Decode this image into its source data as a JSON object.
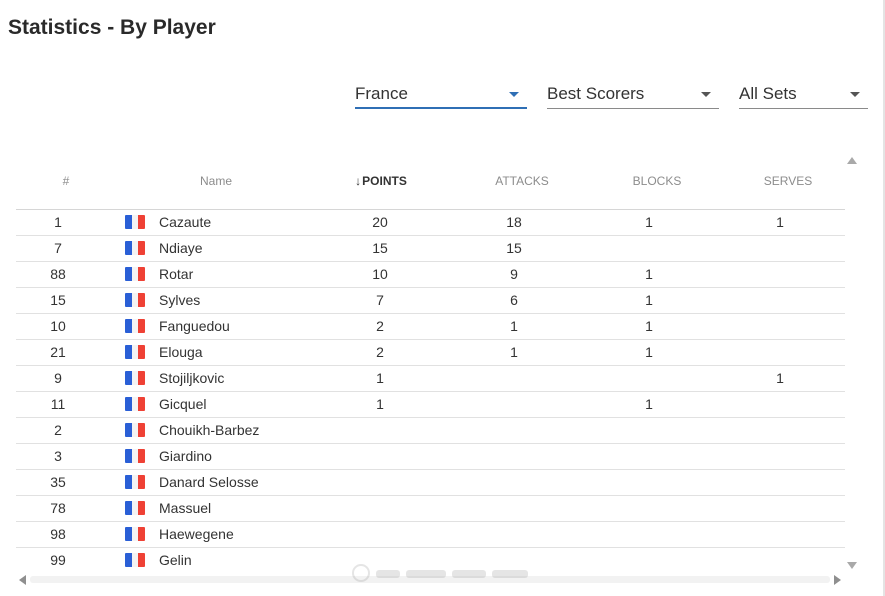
{
  "page": {
    "title": "Statistics - By Player"
  },
  "filters": {
    "country": "France",
    "stat": "Best Scorers",
    "sets": "All Sets"
  },
  "table": {
    "headers": {
      "num": "#",
      "name": "Name",
      "points": "POINTS",
      "points_sort_icon": "↓",
      "attacks": "ATTACKS",
      "blocks": "BLOCKS",
      "serves": "SERVES"
    },
    "rows": [
      {
        "num": "1",
        "name": "Cazaute",
        "points": "20",
        "attacks": "18",
        "blocks": "1",
        "serves": "1"
      },
      {
        "num": "7",
        "name": "Ndiaye",
        "points": "15",
        "attacks": "15",
        "blocks": "",
        "serves": ""
      },
      {
        "num": "88",
        "name": "Rotar",
        "points": "10",
        "attacks": "9",
        "blocks": "1",
        "serves": ""
      },
      {
        "num": "15",
        "name": "Sylves",
        "points": "7",
        "attacks": "6",
        "blocks": "1",
        "serves": ""
      },
      {
        "num": "10",
        "name": "Fanguedou",
        "points": "2",
        "attacks": "1",
        "blocks": "1",
        "serves": ""
      },
      {
        "num": "21",
        "name": "Elouga",
        "points": "2",
        "attacks": "1",
        "blocks": "1",
        "serves": ""
      },
      {
        "num": "9",
        "name": "Stojiljkovic",
        "points": "1",
        "attacks": "",
        "blocks": "",
        "serves": "1"
      },
      {
        "num": "11",
        "name": "Gicquel",
        "points": "1",
        "attacks": "",
        "blocks": "1",
        "serves": ""
      },
      {
        "num": "2",
        "name": "Chouikh-Barbez",
        "points": "",
        "attacks": "",
        "blocks": "",
        "serves": ""
      },
      {
        "num": "3",
        "name": "Giardino",
        "points": "",
        "attacks": "",
        "blocks": "",
        "serves": ""
      },
      {
        "num": "35",
        "name": "Danard Selosse",
        "points": "",
        "attacks": "",
        "blocks": "",
        "serves": ""
      },
      {
        "num": "78",
        "name": "Massuel",
        "points": "",
        "attacks": "",
        "blocks": "",
        "serves": ""
      },
      {
        "num": "98",
        "name": "Haewegene",
        "points": "",
        "attacks": "",
        "blocks": "",
        "serves": ""
      },
      {
        "num": "99",
        "name": "Gelin",
        "points": "",
        "attacks": "",
        "blocks": "",
        "serves": ""
      }
    ]
  },
  "icons": {
    "flag": "france-flag-icon",
    "dropdown": "chevron-down-icon",
    "scroll_up": "scroll-up-icon",
    "scroll_down": "scroll-down-icon",
    "scroll_left": "scroll-left-icon",
    "scroll_right": "scroll-right-icon"
  },
  "colors": {
    "accent": "#2f6fb5",
    "flag_blue": "#2a5fd6",
    "flag_white": "#f4f4f4",
    "flag_red": "#ef4135"
  }
}
